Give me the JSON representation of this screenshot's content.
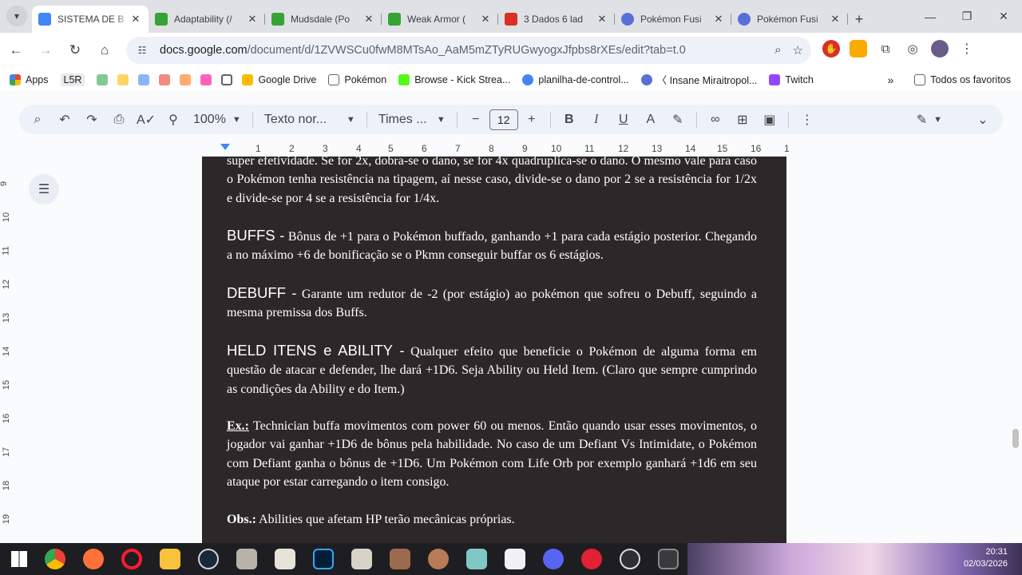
{
  "tabs": [
    {
      "title": "SISTEMA DE B",
      "color": "#4285f4",
      "active": true
    },
    {
      "title": "Adaptability (/",
      "color": "#37a337"
    },
    {
      "title": "Mudsdale (Po",
      "color": "#37a337"
    },
    {
      "title": "Weak Armor (",
      "color": "#37a337"
    },
    {
      "title": "3 Dados 6 lad",
      "color": "#d93025"
    },
    {
      "title": "Pokémon Fusi",
      "color": "#5a6fd6"
    },
    {
      "title": "Pokémon Fusi",
      "color": "#5a6fd6"
    }
  ],
  "address": {
    "host": "docs.google.com",
    "path": "/document/d/1ZVWSCu0fwM8MTsAo_AaM5mZTyRUGwyogxJfpbs8rXEs/edit?tab=t.0"
  },
  "bookmarks": {
    "apps": "Apps",
    "lsr": "L5R",
    "items": [
      {
        "label": "Google Drive",
        "color": "#fbbc04"
      },
      {
        "label": "Pokémon",
        "color": "#5f6368"
      },
      {
        "label": "Browse - Kick Strea...",
        "color": "#53fc18"
      },
      {
        "label": "planilha-de-control...",
        "color": "#4285f4"
      },
      {
        "label": "〈 Insane Miraitropol...",
        "color": "#5a6fd6"
      },
      {
        "label": "Twitch",
        "color": "#9146ff"
      }
    ],
    "all": "Todos os favoritos"
  },
  "toolbar": {
    "zoom": "100%",
    "style": "Texto nor...",
    "font": "Times ...",
    "size": "12"
  },
  "ruler": [
    "1",
    "2",
    "3",
    "4",
    "5",
    "6",
    "7",
    "8",
    "9",
    "10",
    "11",
    "12",
    "13",
    "14",
    "15",
    "16",
    "1"
  ],
  "vruler": [
    "9",
    "10",
    "11",
    "12",
    "13",
    "14",
    "15",
    "16",
    "17",
    "18",
    "19"
  ],
  "doc": {
    "p1": "super efetividade. Se for 2x, dobra-se o dano, se for 4x quadruplica-se o dano. O mesmo vale para caso o Pokémon tenha resistência na tipagem, aí nesse caso, divide-se o dano por 2 se a resistência for 1/2x e divide-se por 4 se a resistência for 1/4x.",
    "buffs_h": "BUFFS -",
    "buffs": " Bônus de +1 para o Pokémon buffado, ganhando +1 para cada estágio posterior. Chegando a no máximo +6 de bonificação se o Pkmn conseguir buffar os 6 estágios.",
    "debuff_h": "DEBUFF -",
    "debuff": " Garante um redutor de -2 (por estágio) ao pokémon que sofreu o Debuff, seguindo a mesma premissa dos Buffs.",
    "held_h": "HELD ITENS e ABILITY -",
    "held": " Qualquer efeito que beneficie o Pokémon de alguma forma em questão de atacar e defender, lhe dará +1D6. Seja Ability ou Held Item. (Claro que sempre cumprindo as condições da Ability e do Item.)",
    "ex_h": "Ex.:",
    "ex": " Technician buffa movimentos com power 60 ou menos. Então quando usar esses movimentos, o jogador vai ganhar +1D6 de bônus pela habilidade. No caso de um Defiant Vs Intimidate, o Pokémon com Defiant ganha o bônus de +1D6. Um Pokémon com Life Orb por exemplo ganhará +1d6 em seu ataque por estar carregando o item consigo.",
    "obs_h": "Obs.:",
    "obs": " Abilities que afetam HP terão mecânicas próprias."
  },
  "clock": {
    "time": "20:31",
    "date": "02/03/2026"
  }
}
